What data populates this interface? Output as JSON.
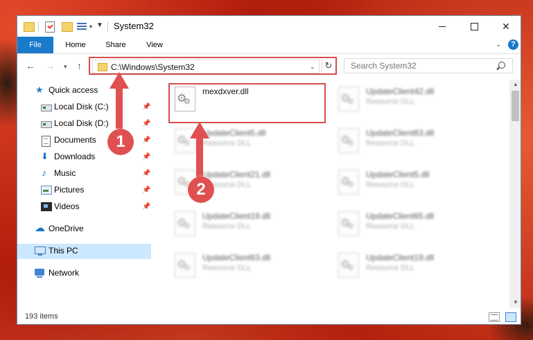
{
  "window": {
    "title": "System32",
    "minimize_glyph": "",
    "close_glyph": "✕"
  },
  "quick_access_toolbar": {
    "dropdown_glyph": "▾",
    "menu_glyph": "▼"
  },
  "ribbon": {
    "tabs": [
      {
        "label": "File"
      },
      {
        "label": "Home"
      },
      {
        "label": "Share"
      },
      {
        "label": "View"
      }
    ],
    "expand_glyph": "⌄",
    "help_label": "?"
  },
  "navigation": {
    "back_glyph": "←",
    "forward_glyph": "→",
    "recent_glyph": "▾",
    "up_glyph": "↑",
    "address": "C:\\Windows\\System32",
    "address_dropdown_glyph": "⌄",
    "refresh_glyph": "↻",
    "search_placeholder": "Search System32"
  },
  "sidebar": {
    "pin_glyph": "📌",
    "items": [
      {
        "label": "Quick access",
        "icon": "star-icon",
        "pinned": false
      },
      {
        "label": "Local Disk (C:)",
        "icon": "disk-icon",
        "pinned": true
      },
      {
        "label": "Local Disk (D:)",
        "icon": "disk-icon",
        "pinned": true
      },
      {
        "label": "Documents",
        "icon": "documents-icon",
        "pinned": true
      },
      {
        "label": "Downloads",
        "icon": "downloads-icon",
        "pinned": true
      },
      {
        "label": "Music",
        "icon": "music-icon",
        "pinned": true
      },
      {
        "label": "Pictures",
        "icon": "pictures-icon",
        "pinned": true
      },
      {
        "label": "Videos",
        "icon": "videos-icon",
        "pinned": true
      },
      {
        "label": "OneDrive",
        "icon": "onedrive-icon",
        "pinned": false
      },
      {
        "label": "This PC",
        "icon": "this-pc-icon",
        "pinned": false,
        "selected": true
      },
      {
        "label": "Network",
        "icon": "network-icon",
        "pinned": false
      }
    ]
  },
  "files": [
    {
      "name": "mexdxver.dll",
      "type": "",
      "highlighted": true
    },
    {
      "name": "UpdateClient42.dll",
      "type": "Resource DLL"
    },
    {
      "name": "UpdateClient5.dll",
      "type": "Resource DLL"
    },
    {
      "name": "UpdateClient63.dll",
      "type": "Resource DLL"
    },
    {
      "name": "UpdateClient21.dll",
      "type": "Resource DLL"
    },
    {
      "name": "UpdateClient5.dll",
      "type": "Resource DLL"
    },
    {
      "name": "UpdateClient19.dll",
      "type": "Resource DLL"
    },
    {
      "name": "UpdateClient65.dll",
      "type": "Resource DLL"
    },
    {
      "name": "UpdateClient63.dll",
      "type": "Resource DLL"
    },
    {
      "name": "UpdateClient19.dll",
      "type": "Resource DLL"
    }
  ],
  "scrollbar": {
    "up_glyph": "▲",
    "down_glyph": "▼"
  },
  "status_bar": {
    "item_count": "193 items"
  },
  "annotations": {
    "badge_1": "1",
    "badge_2": "2",
    "color": "#e05050"
  },
  "colors": {
    "accent": "#1979ca",
    "highlight_border": "#d64c4c",
    "selected_bg": "#cce8ff"
  }
}
